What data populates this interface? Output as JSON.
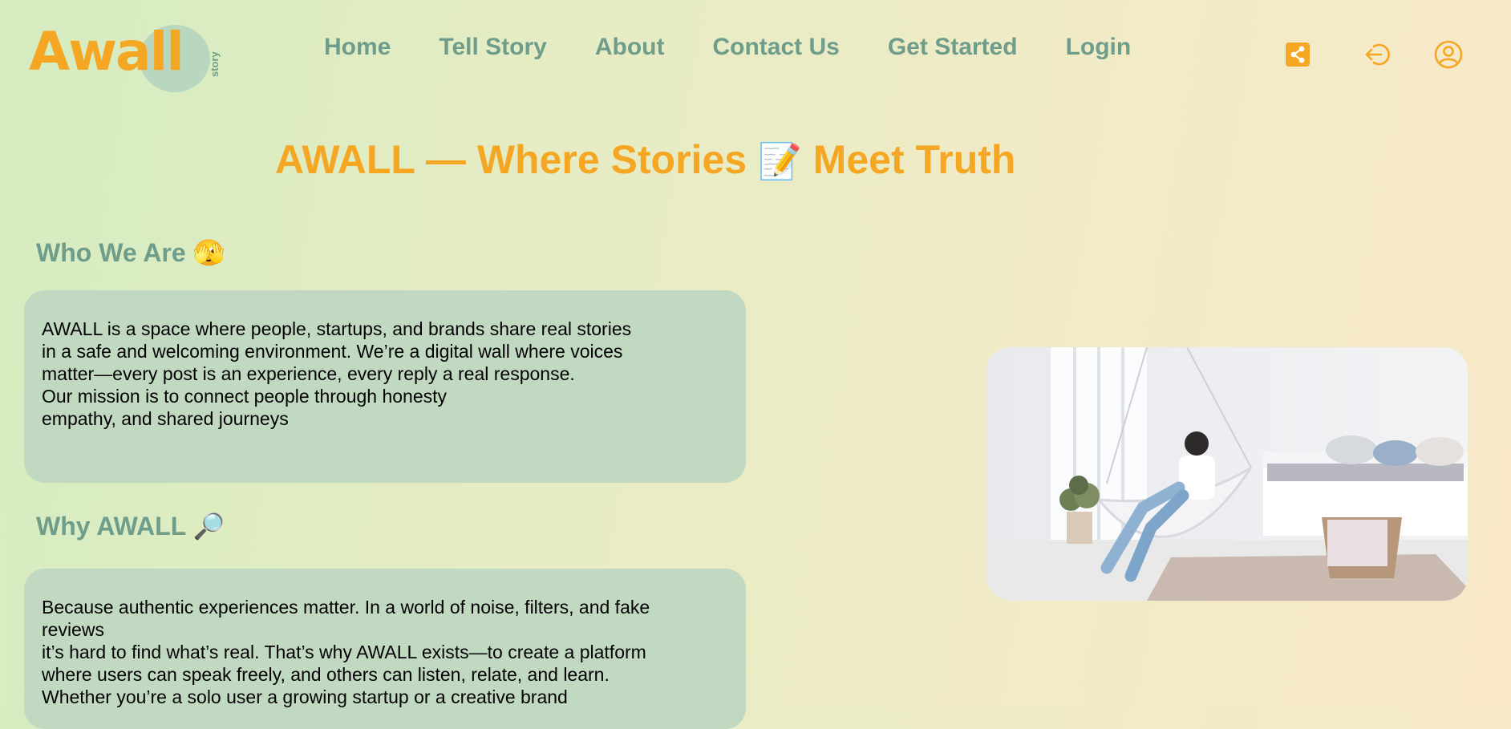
{
  "brand": {
    "name": "Awall",
    "tagline": "story"
  },
  "nav": [
    "Home",
    "Tell Story",
    "About",
    "Contact Us",
    "Get Started",
    "Login"
  ],
  "header_icons": [
    "share-icon",
    "logout-icon",
    "user-profile-icon"
  ],
  "colors": {
    "accent": "#f5a623",
    "nav": "#6f9d8b",
    "card": "#c1d8c1"
  },
  "headline": {
    "text_before": "AWALL — Where Stories",
    "emoji": "📝",
    "text_after": "Meet Truth"
  },
  "who_we_are": {
    "title": "Who We Are",
    "emoji": "🫣",
    "lines": [
      "AWALL is a space where people, startups, and brands share real stories",
      "in a safe and welcoming environment. We’re a digital wall where voices",
      "matter—every post is an experience, every reply a real response.",
      "Our mission is to connect people through honesty",
      "empathy, and shared journeys"
    ]
  },
  "why_awall": {
    "title": "Why AWALL",
    "emoji": "🔎",
    "lines": [
      "Because authentic experiences matter. In a world of noise, filters, and fake",
      "reviews",
      "it’s hard to find what’s real. That’s why AWALL exists—to create a platform",
      "where users can speak freely, and others can listen, relate, and learn.",
      "Whether you’re a solo user a growing startup or a creative brand"
    ]
  },
  "hero_image": {
    "icon": "woman-in-hanging-chair-photo"
  }
}
